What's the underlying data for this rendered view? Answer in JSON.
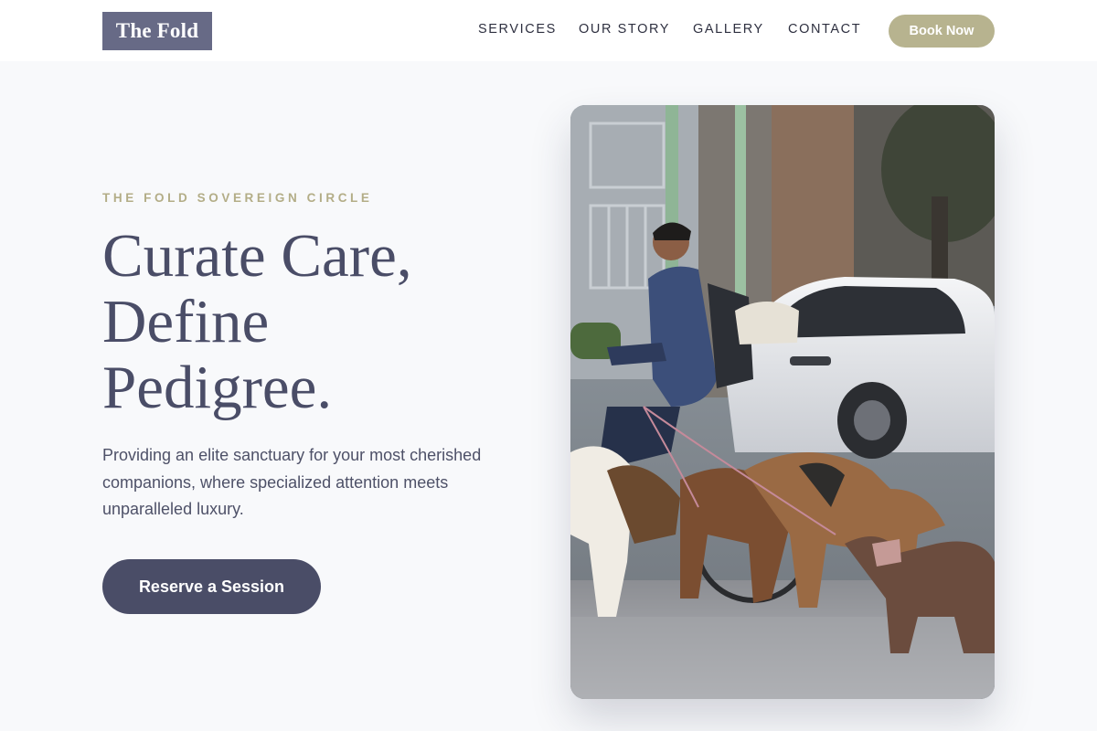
{
  "header": {
    "logo": "The Fold",
    "nav": [
      {
        "id": "services",
        "label": "SERVICES"
      },
      {
        "id": "our-story",
        "label": "OUR STORY"
      },
      {
        "id": "gallery",
        "label": "GALLERY"
      },
      {
        "id": "contact",
        "label": "CONTACT"
      }
    ],
    "cta_label": "Book Now"
  },
  "hero": {
    "eyebrow": "THE FOLD SOVEREIGN CIRCLE",
    "headline_lines": [
      "Curate Care,",
      "Define",
      "Pedigree."
    ],
    "description": "Providing an elite sanctuary for your most cherished companions, where specialized attention meets unparalleled luxury.",
    "cta_label": "Reserve a Session"
  },
  "colors": {
    "accent": "#b7b38f",
    "primary": "#4a4d67",
    "logo_bg": "#676a86",
    "background": "#f8f9fb"
  }
}
